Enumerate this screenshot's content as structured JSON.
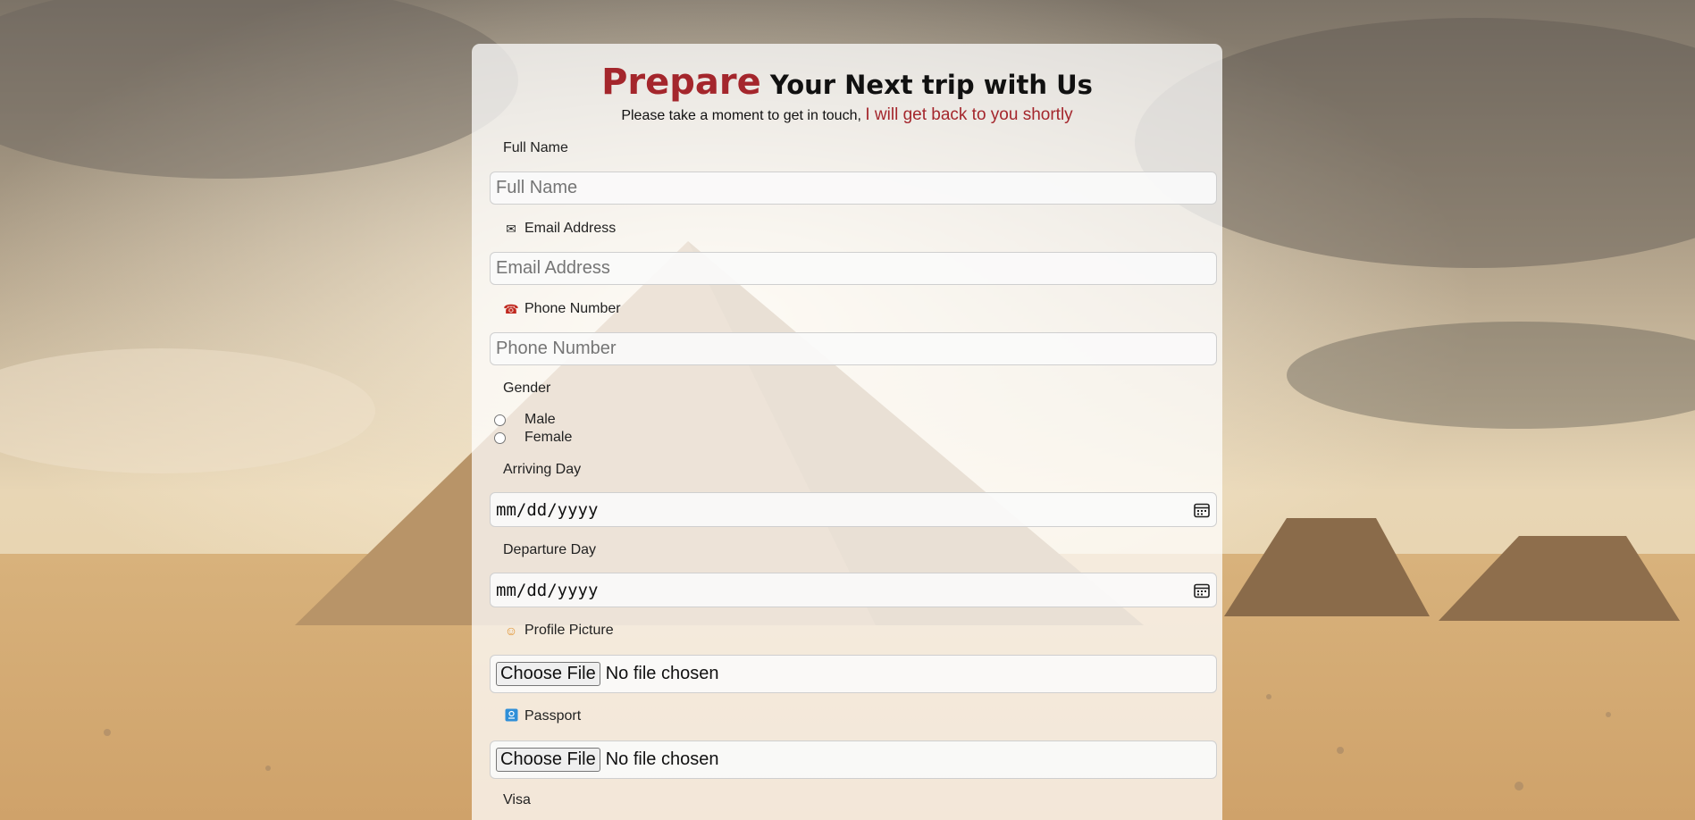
{
  "header": {
    "title_accent": "Prepare",
    "title_rest": " Your Next trip with Us",
    "subtitle_plain": "Please take a moment to get in touch, ",
    "subtitle_accent": "I will get back to you shortly"
  },
  "form": {
    "full_name": {
      "label": "Full Name",
      "placeholder": "Full Name",
      "value": ""
    },
    "email": {
      "label": "Email Address",
      "placeholder": "Email Address",
      "icon": "envelope-icon",
      "value": ""
    },
    "phone": {
      "label": "Phone Number",
      "placeholder": "Phone Number",
      "icon": "telephone-icon",
      "value": ""
    },
    "gender": {
      "label": "Gender",
      "options": [
        "Male",
        "Female"
      ],
      "selected": null
    },
    "arriving": {
      "label": "Arriving Day",
      "placeholder": "mm/dd/yyyy",
      "icon": "calendar-icon"
    },
    "departure": {
      "label": "Departure Day",
      "placeholder": "mm/dd/yyyy",
      "icon": "calendar-icon"
    },
    "profile_picture": {
      "label": "Profile Picture",
      "icon": "face-icon",
      "button": "Choose File",
      "status": "No file chosen"
    },
    "passport": {
      "label": "Passport",
      "icon": "passport-icon",
      "button": "Choose File",
      "status": "No file chosen"
    },
    "visa": {
      "label": "Visa"
    }
  },
  "colors": {
    "accent": "#a4262c",
    "card_background": "rgba(255,255,255,0.74)"
  }
}
